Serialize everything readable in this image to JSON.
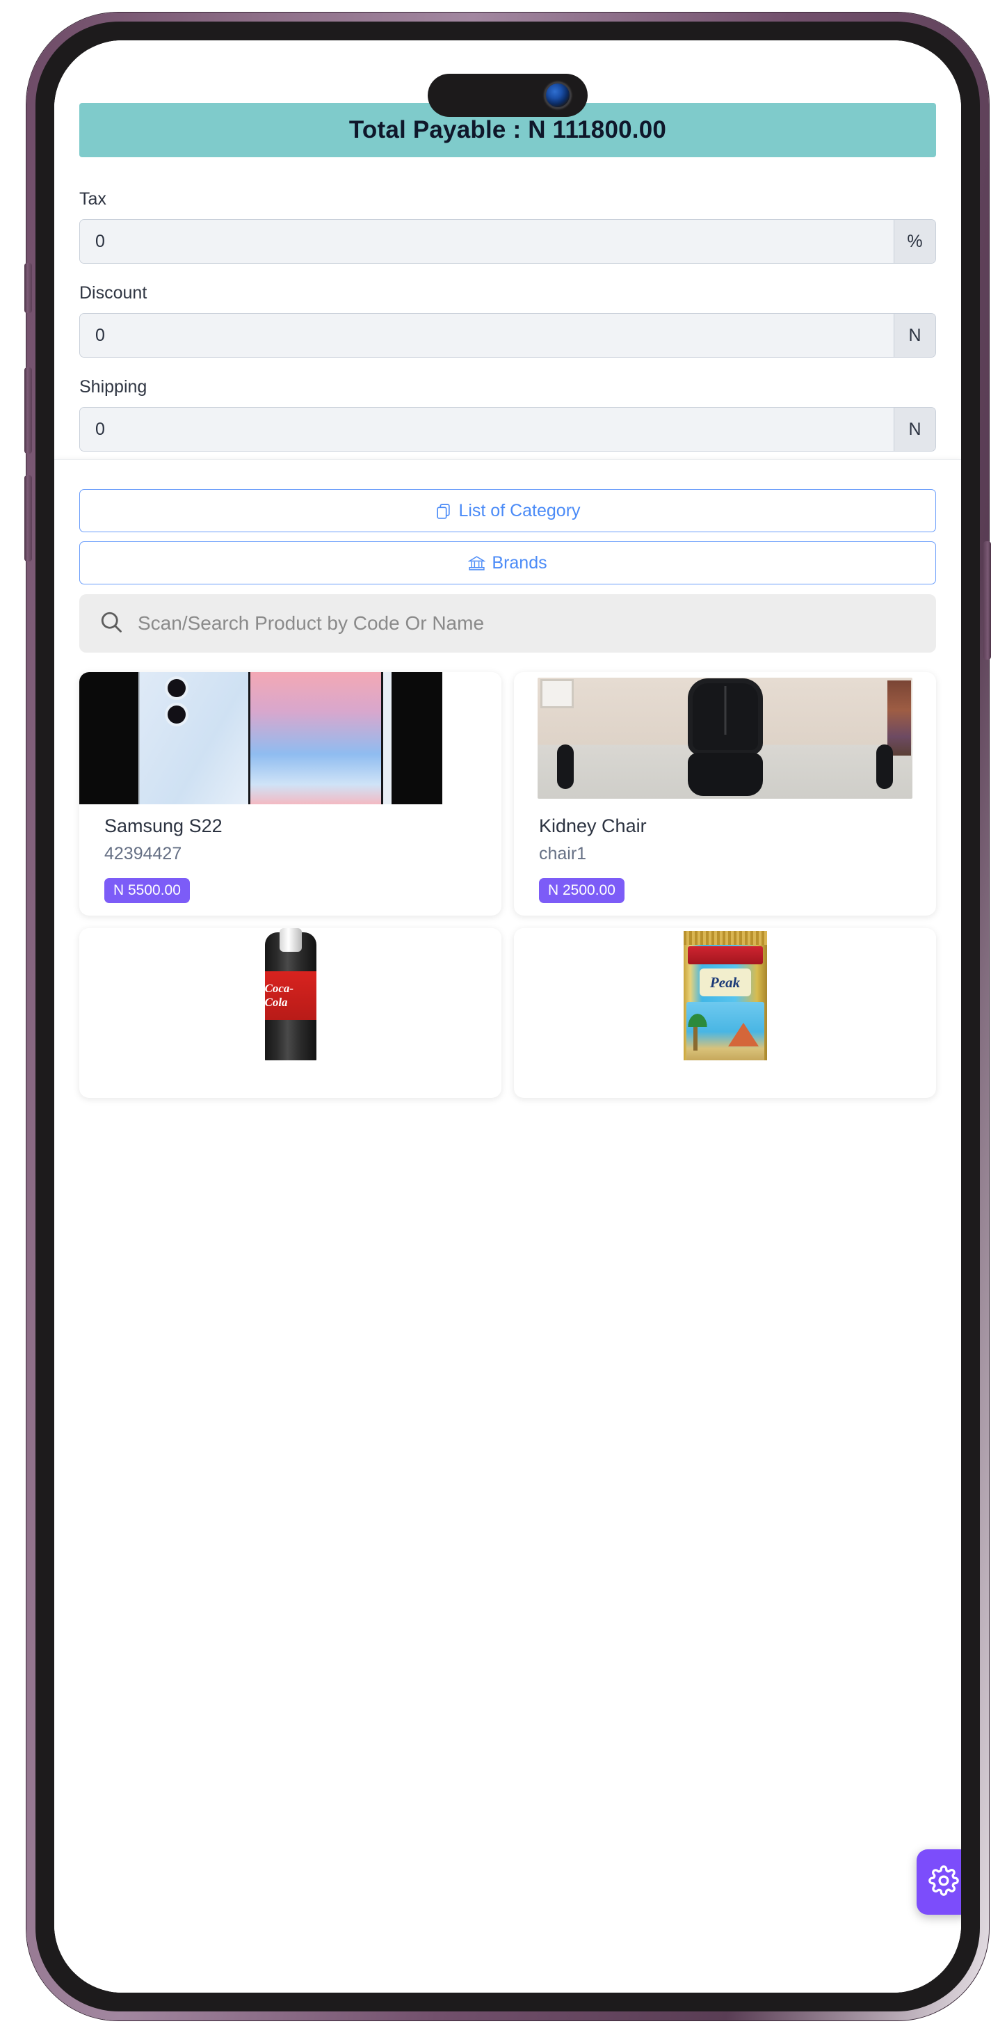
{
  "device": {
    "frame_color": "#7b5a75",
    "island": {
      "camera_icon": "camera-lens-icon"
    }
  },
  "totals": {
    "banner_label": "Total Payable : N 111800.00",
    "banner_color": "#7fcbcb",
    "fields": [
      {
        "label": "Tax",
        "value": "0",
        "placeholder": "0",
        "suffix": "%"
      },
      {
        "label": "Discount",
        "value": "0",
        "placeholder": "0",
        "suffix": "N"
      },
      {
        "label": "Shipping",
        "value": "0",
        "placeholder": "0",
        "suffix": "N"
      }
    ]
  },
  "filters": {
    "category_button": {
      "label": "List of Category",
      "icon": "copy-stack-icon"
    },
    "brands_button": {
      "label": "Brands",
      "icon": "bank-icon"
    },
    "accent_color": "#4b8bf7"
  },
  "search": {
    "placeholder": "Scan/Search Product by Code Or Name",
    "value": "",
    "icon": "search-icon"
  },
  "products": [
    {
      "name": "Samsung S22",
      "code": "42394427",
      "price": "N 5500.00",
      "thumb": "samsung-phone-image"
    },
    {
      "name": "Kidney Chair",
      "code": "chair1",
      "price": "N 2500.00",
      "thumb": "office-chair-image"
    },
    {
      "name": "",
      "code": "",
      "price": "",
      "thumb": "coca-cola-bottle-image"
    },
    {
      "name": "",
      "code": "",
      "price": "",
      "thumb": "peak-milk-powder-image"
    }
  ],
  "price_badge_color": "#7c5cf7",
  "floating_action": {
    "icon": "gear-icon",
    "color": "#7c4dfb"
  }
}
